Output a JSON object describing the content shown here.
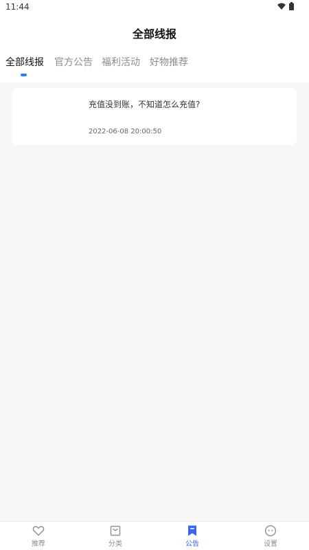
{
  "status_bar": {
    "time": "11:44",
    "icons": [
      "wifi-icon",
      "battery-icon"
    ]
  },
  "header": {
    "title": "全部线报"
  },
  "tabs": [
    {
      "label": "全部线报",
      "active": true
    },
    {
      "label": "官方公告",
      "active": false
    },
    {
      "label": "福利活动",
      "active": false
    },
    {
      "label": "好物推荐",
      "active": false
    }
  ],
  "posts": [
    {
      "title": "充值没到账，不知道怎么充值?",
      "time": "2022-06-08 20:00:50"
    }
  ],
  "bottom_nav": [
    {
      "label": "推荐",
      "icon": "heart-icon",
      "active": false
    },
    {
      "label": "分类",
      "icon": "shopping-bag-icon",
      "active": false
    },
    {
      "label": "公告",
      "icon": "bookmark-icon",
      "active": true
    },
    {
      "label": "设置",
      "icon": "face-icon",
      "active": false
    }
  ],
  "colors": {
    "accent": "#2f80ed",
    "nav_active": "#3a63f0",
    "background": "#f7f7f8"
  }
}
